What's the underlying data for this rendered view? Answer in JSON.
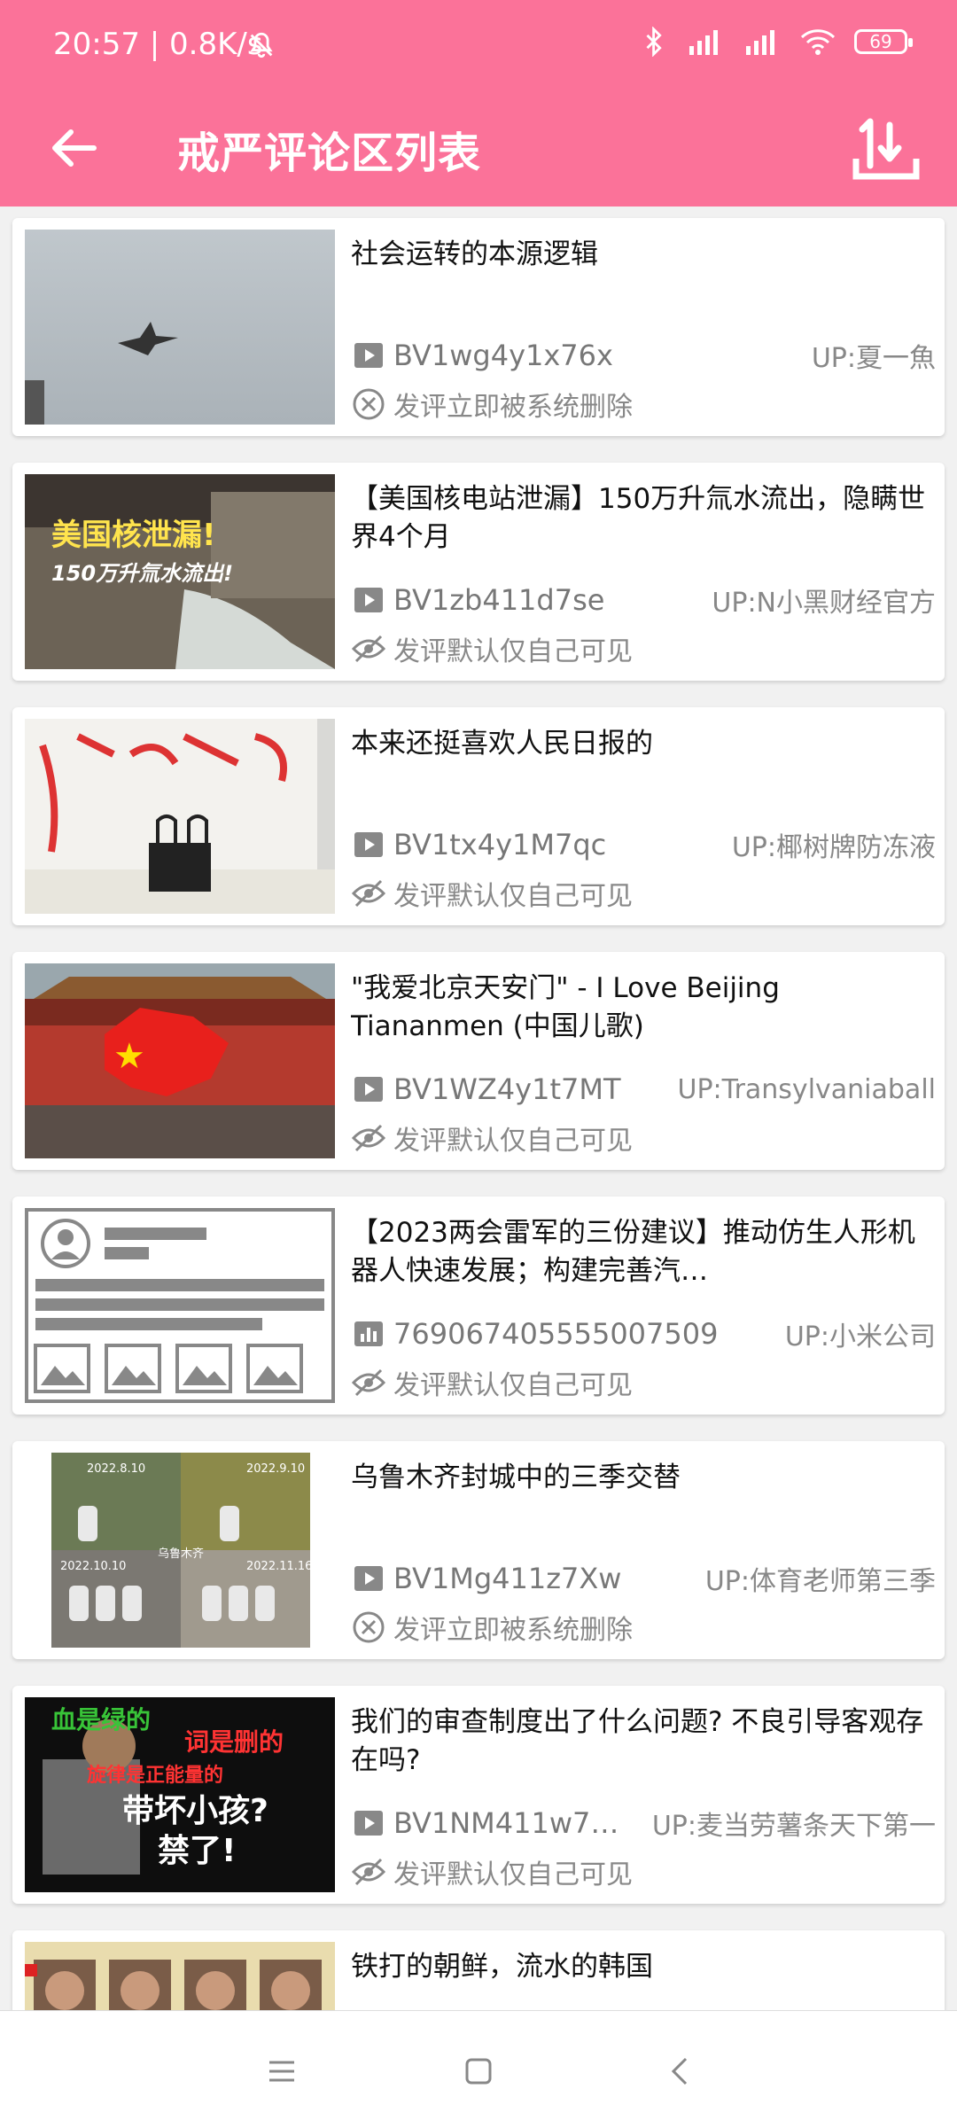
{
  "status_bar": {
    "time": "20:57 | 0.8K/s",
    "battery": "69"
  },
  "app_bar": {
    "title": "戒严评论区列表"
  },
  "items": [
    {
      "title": "社会运转的本源逻辑",
      "id": "BV1wg4y1x76x",
      "up": "UP:夏一魚",
      "status": "发评立即被系统删除",
      "status_icon": "deleted-icon"
    },
    {
      "title": "【美国核电站泄漏】150万升氚水流出，隐瞒世界4个月",
      "id": "BV1zb411d7se",
      "up": "UP:N小黑财经官方",
      "status": "发评默认仅自己可见",
      "status_icon": "eye-off-icon",
      "thumb_text1": "美国核泄漏!",
      "thumb_text2": "150万升氚水流出!"
    },
    {
      "title": "本来还挺喜欢人民日报的",
      "id": "BV1tx4y1M7qc",
      "up": "UP:椰树牌防冻液",
      "status": "发评默认仅自己可见",
      "status_icon": "eye-off-icon"
    },
    {
      "title": "\"我爱北京天安门\" - I Love Beijing Tiananmen (中国儿歌)",
      "id": "BV1WZ4y1t7MT",
      "up": "UP:Transylvaniaball",
      "status": "发评默认仅自己可见",
      "status_icon": "eye-off-icon"
    },
    {
      "title": "【2023两会雷军的三份建议】推动仿生人形机器人快速发展；构建完善汽…",
      "id": "769067405555007509",
      "up": "UP:小米公司",
      "status": "发评默认仅自己可见",
      "status_icon": "eye-off-icon",
      "id_icon": "stats-icon"
    },
    {
      "title": "乌鲁木齐封城中的三季交替",
      "id": "BV1Mg411z7Xw",
      "up": "UP:体育老师第三季",
      "status": "发评立即被系统删除",
      "status_icon": "deleted-icon",
      "thumb_dates": [
        "2022.8.10",
        "2022.9.10",
        "2022.10.10",
        "2022.11.16"
      ],
      "thumb_label": "乌鲁木齐"
    },
    {
      "title": "我们的审查制度出了什么问题? 不良引导客观存在吗?",
      "id": "BV1NM411w7…",
      "up": "UP:麦当劳薯条天下第一",
      "status": "发评默认仅自己可见",
      "status_icon": "eye-off-icon",
      "thumb_lines": [
        "血是绿的",
        "词是删的",
        "旋律是正能量的",
        "带坏小孩?",
        "禁了!"
      ]
    },
    {
      "title": "铁打的朝鲜，流水的韩国",
      "id": "",
      "up": "",
      "status": "",
      "status_icon": ""
    }
  ],
  "colors": {
    "accent": "#fb7299",
    "card_bg": "#ffffff",
    "page_bg": "#f1f1f1",
    "secondary_text": "#888888"
  },
  "nav": {
    "menu": "menu-icon",
    "home": "home-icon",
    "back": "back-icon"
  }
}
